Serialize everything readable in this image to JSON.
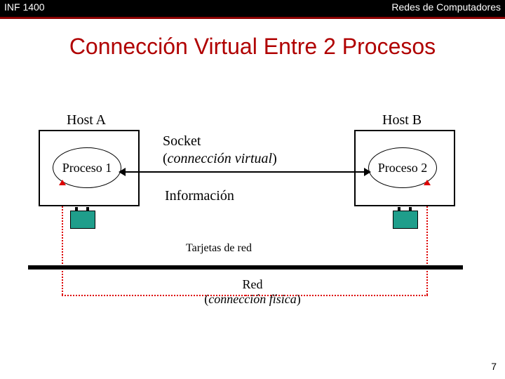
{
  "header": {
    "course_code": "INF 1400",
    "course_title": "Redes de Computadores"
  },
  "slide": {
    "title": "Connección Virtual Entre 2 Procesos",
    "page_number": "7"
  },
  "diagram": {
    "host_a": {
      "label": "Host A",
      "process": "Proceso 1"
    },
    "host_b": {
      "label": "Host B",
      "process": "Proceso 2"
    },
    "socket": {
      "title": "Socket",
      "paren_open": "(",
      "italic": "connección virtual",
      "paren_close": ")"
    },
    "info_label": "Información",
    "nic_label": "Tarjetas de red",
    "network": {
      "line1": "Red",
      "paren_open": "(",
      "italic": "connección física",
      "paren_close": ")"
    }
  },
  "colors": {
    "accent_red": "#b00000",
    "nic_fill": "#1f9e8b",
    "dotted_red": "#d00000"
  }
}
